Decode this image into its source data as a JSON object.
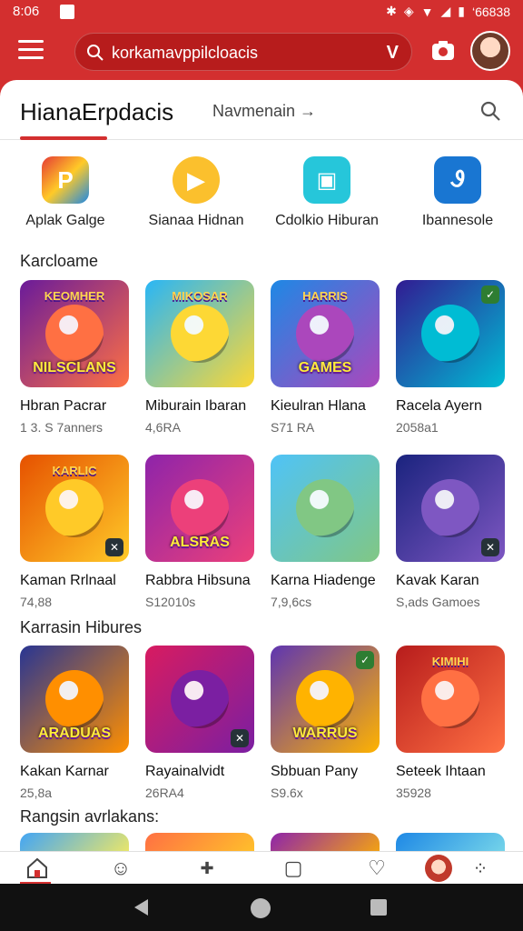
{
  "status": {
    "time": "8:06",
    "battery_text": "‘66838"
  },
  "search": {
    "text": "korkamavppilcloacis",
    "voice_glyph": "V"
  },
  "tabs": {
    "active": "HianaErpdacis",
    "secondary": "Navmenain →"
  },
  "quick_actions": [
    {
      "label": "Aplak Galge",
      "color": "#e53935"
    },
    {
      "label": "Sianaa Hidnan",
      "color": "#fbc02d"
    },
    {
      "label": "Cdolkio Hiburan",
      "color": "#26c6da"
    },
    {
      "label": "Ibannesole",
      "color": "#1976d2"
    }
  ],
  "sections": [
    {
      "title": "Karcloame",
      "games": [
        {
          "name": "Hbran Pacrar",
          "meta": "1 3. S  7anners",
          "thumb_top": "KEOMHER",
          "thumb_bottom": "NILSCLANS",
          "colors": [
            "#6a1b9a",
            "#ff7043"
          ],
          "badge": ""
        },
        {
          "name": "Miburain Ibaran",
          "meta": "4,6RA",
          "thumb_top": "MIKOSAR",
          "thumb_bottom": "",
          "colors": [
            "#29b6f6",
            "#fdd835"
          ],
          "badge": ""
        },
        {
          "name": "Kieulran Hlana",
          "meta": "S71 RA",
          "thumb_top": "HARRIS",
          "thumb_bottom": "GAMES",
          "colors": [
            "#1e88e5",
            "#ab47bc"
          ],
          "badge": ""
        },
        {
          "name": "Racela Ayern",
          "meta": "2058a1",
          "thumb_top": "",
          "thumb_bottom": "",
          "colors": [
            "#311b92",
            "#00bcd4"
          ],
          "badge": "check"
        }
      ]
    },
    {
      "title": "",
      "games": [
        {
          "name": "Kaman Rrlnaal",
          "meta": "74,88",
          "thumb_top": "KARLIC",
          "thumb_bottom": "",
          "colors": [
            "#e65100",
            "#ffca28"
          ],
          "badge": "tool"
        },
        {
          "name": "Rabbra Hibsuna",
          "meta": "S12010s",
          "thumb_top": "",
          "thumb_bottom": "ALSRAS",
          "colors": [
            "#8e24aa",
            "#ec407a"
          ],
          "badge": ""
        },
        {
          "name": "Karna Hiadenge",
          "meta": "7,9,6cs",
          "thumb_top": "",
          "thumb_bottom": "",
          "colors": [
            "#4fc3f7",
            "#81c784"
          ],
          "badge": ""
        },
        {
          "name": "Kavak Karan",
          "meta": "S,ads Gamoes",
          "thumb_top": "",
          "thumb_bottom": "",
          "colors": [
            "#1a237e",
            "#7e57c2"
          ],
          "badge": "tool"
        }
      ]
    },
    {
      "title": "Karrasin Hibures",
      "games": [
        {
          "name": "Kakan Karnar",
          "meta": "25,8a",
          "thumb_top": "",
          "thumb_bottom": "ARADUAS",
          "colors": [
            "#283593",
            "#ff8f00"
          ],
          "badge": ""
        },
        {
          "name": "Rayainalvidt",
          "meta": "26RA4",
          "thumb_top": "",
          "thumb_bottom": "",
          "colors": [
            "#d81b60",
            "#7b1fa2"
          ],
          "badge": "tool"
        },
        {
          "name": "Sbbuan Pany",
          "meta": "S9.6x",
          "thumb_top": "",
          "thumb_bottom": "WARRUS",
          "colors": [
            "#5e35b1",
            "#ffb300"
          ],
          "badge": "check"
        },
        {
          "name": "Seteek Ihtaan",
          "meta": "35928",
          "thumb_top": "KIMIHI",
          "thumb_bottom": "",
          "colors": [
            "#b71c1c",
            "#ff7043"
          ],
          "badge": ""
        }
      ]
    },
    {
      "title": "Rangsin avrlakans:",
      "games": []
    }
  ]
}
